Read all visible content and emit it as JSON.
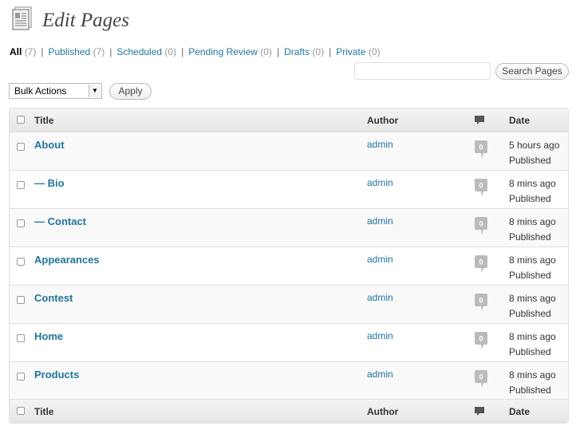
{
  "header": {
    "title": "Edit Pages",
    "icon": "pages-icon"
  },
  "filters": [
    {
      "label": "All",
      "count": "(7)",
      "current": true
    },
    {
      "label": "Published",
      "count": "(7)"
    },
    {
      "label": "Scheduled",
      "count": "(0)"
    },
    {
      "label": "Pending Review",
      "count": "(0)"
    },
    {
      "label": "Drafts",
      "count": "(0)"
    },
    {
      "label": "Private",
      "count": "(0)"
    }
  ],
  "filter_separator": "|",
  "search": {
    "value": "",
    "button_label": "Search Pages"
  },
  "bulk": {
    "selected": "Bulk Actions",
    "apply_label": "Apply"
  },
  "table": {
    "columns": {
      "title": "Title",
      "author": "Author",
      "comments": "comments-icon",
      "date": "Date"
    },
    "rows": [
      {
        "title": "About",
        "author": "admin",
        "comments": "0",
        "date": "5 hours ago",
        "status": "Published"
      },
      {
        "title": "— Bio",
        "author": "admin",
        "comments": "0",
        "date": "8 mins ago",
        "status": "Published"
      },
      {
        "title": "— Contact",
        "author": "admin",
        "comments": "0",
        "date": "8 mins ago",
        "status": "Published"
      },
      {
        "title": "Appearances",
        "author": "admin",
        "comments": "0",
        "date": "8 mins ago",
        "status": "Published"
      },
      {
        "title": "Contest",
        "author": "admin",
        "comments": "0",
        "date": "8 mins ago",
        "status": "Published"
      },
      {
        "title": "Home",
        "author": "admin",
        "comments": "0",
        "date": "8 mins ago",
        "status": "Published"
      },
      {
        "title": "Products",
        "author": "admin",
        "comments": "0",
        "date": "8 mins ago",
        "status": "Published"
      }
    ]
  },
  "colors": {
    "link": "#21759b",
    "muted": "#999999",
    "border": "#dfdfdf",
    "bubble": "#bbbbbb"
  }
}
